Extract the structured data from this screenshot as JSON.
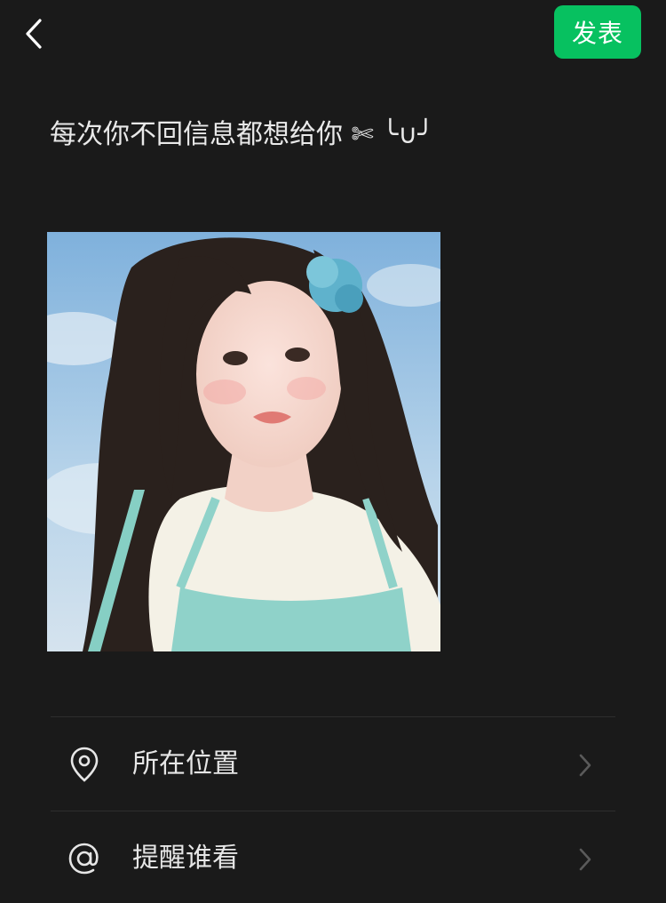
{
  "header": {
    "back_icon": "chevron-left-icon",
    "publish_label": "发表",
    "accent_color": "#07c160"
  },
  "post": {
    "text": "每次你不回信息都想给你 ✄ ╰∪╯"
  },
  "photo": {
    "description_icon": "selfie-photo"
  },
  "options": [
    {
      "icon": "location-pin-icon",
      "label": "所在位置"
    },
    {
      "icon": "at-sign-icon",
      "label": "提醒谁看"
    }
  ]
}
